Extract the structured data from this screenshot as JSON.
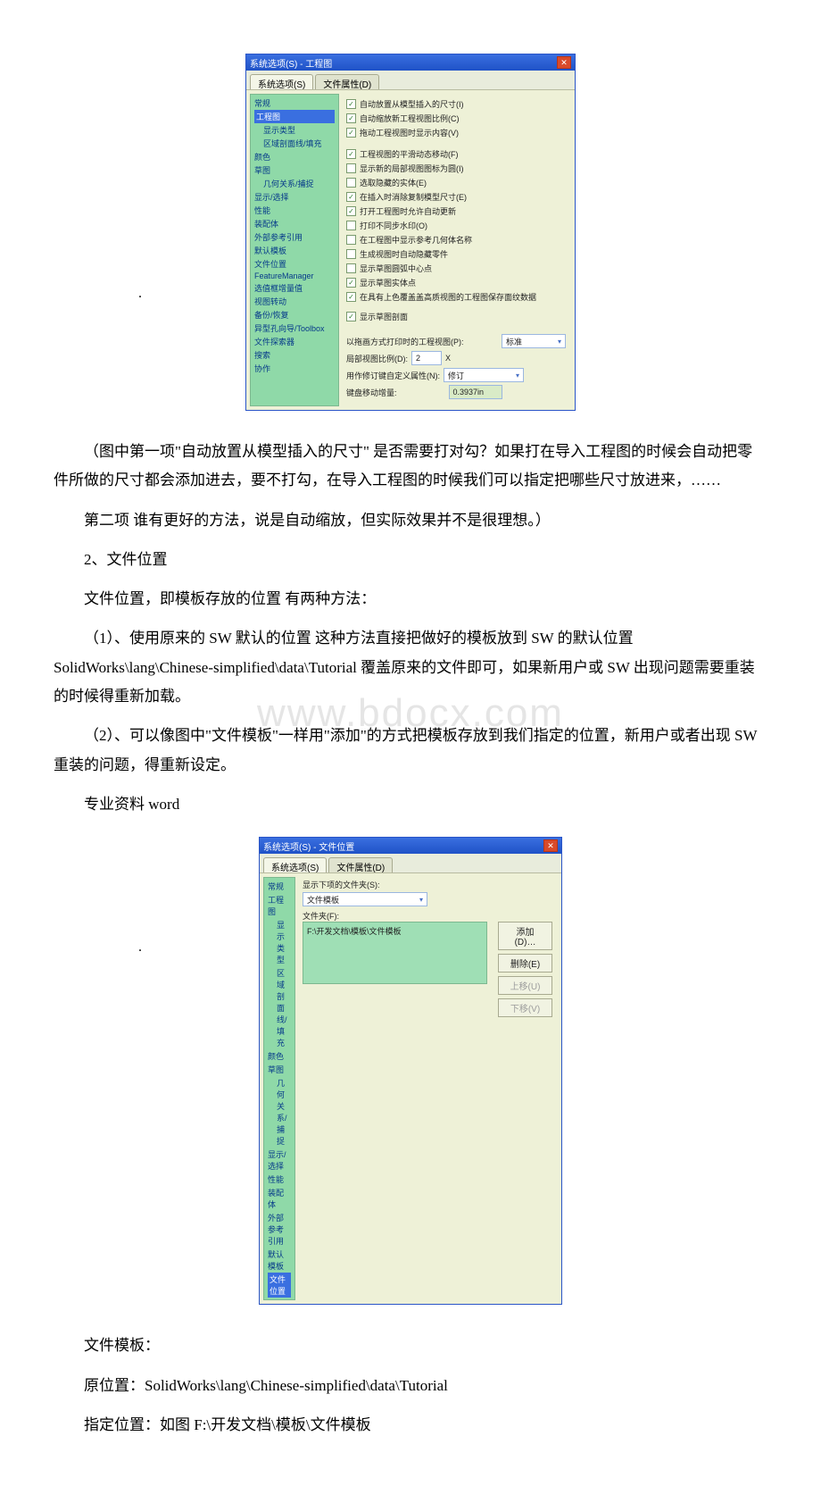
{
  "dialog1": {
    "title": "系统选项(S) - 工程图",
    "tab_system": "系统选项(S)",
    "tab_doc": "文件属性(D)",
    "tree": {
      "t0": "常规",
      "t1": "工程图",
      "t2": "显示类型",
      "t3": "区域剖面线/填充",
      "t4": "颜色",
      "t5": "草图",
      "t6": "几何关系/捕捉",
      "t7": "显示/选择",
      "t8": "性能",
      "t9": "装配体",
      "t10": "外部参考引用",
      "t11": "默认模板",
      "t12": "文件位置",
      "t13": "FeatureManager",
      "t14": "选值框增量值",
      "t15": "视图转动",
      "t16": "备份/恢复",
      "t17": "异型孔向导/Toolbox",
      "t18": "文件探索器",
      "t19": "搜索",
      "t20": "协作"
    },
    "opts": {
      "c0": "自动放置从模型插入的尺寸(I)",
      "c1": "自动缩放新工程视图比例(C)",
      "c2": "拖动工程视图时显示内容(V)",
      "c3": "工程视图的平滑动态移动(F)",
      "c4": "显示新的局部视图图标为圆(I)",
      "c5": "选取隐藏的实体(E)",
      "c6": "在插入时消除复制模型尺寸(E)",
      "c7": "打开工程图时允许自动更新",
      "c8": "打印不同步水印(O)",
      "c9": "在工程图中显示参考几何体名称",
      "c10": "生成视图时自动隐藏零件",
      "c11": "显示草图圆弧中心点",
      "c12": "显示草图实体点",
      "c13": "在具有上色覆盖盖高质视图的工程图保存面纹数据",
      "c14": "显示草图剖面",
      "l0": "以拖画方式打印时的工程视图(P):",
      "v0": "标准",
      "l1": "局部视图比例(D):",
      "v1": "2",
      "v1x": "X",
      "l2": "用作修订键自定义属性(N):",
      "v2": "修订",
      "l3": "键盘移动增量:",
      "v3": "0.3937in"
    }
  },
  "paras": {
    "p1": "（图中第一项\"自动放置从模型插入的尺寸\" 是否需要打对勾？如果打在导入工程图的时候会自动把零件所做的尺寸都会添加进去，要不打勾，在导入工程图的时候我们可以指定把哪些尺寸放进来，……",
    "p2": "第二项 谁有更好的方法，说是自动缩放，但实际效果并不是很理想。）",
    "p3": "2、文件位置",
    "p4": "文件位置，即模板存放的位置 有两种方法：",
    "p5": "（1）、使用原来的 SW 默认的位置 这种方法直接把做好的模板放到 SW 的默认位置 SolidWorks\\lang\\Chinese-simplified\\data\\Tutorial 覆盖原来的文件即可，如果新用户或 SW 出现问题需要重装的时候得重新加载。",
    "p6": "（2）、可以像图中\"文件模板\"一样用\"添加\"的方式把模板存放到我们指定的位置，新用户或者出现 SW 重装的问题，得重新设定。",
    "p7": "专业资料 word",
    "p8": "文件模板：",
    "p9": "原位置：SolidWorks\\lang\\Chinese-simplified\\data\\Tutorial",
    "p10": "指定位置：如图 F:\\开发文档\\模板\\文件模板"
  },
  "dialog2": {
    "title": "系统选项(S) - 文件位置",
    "tab_system": "系统选项(S)",
    "tab_doc": "文件属性(D)",
    "tree": {
      "t0": "常规",
      "t1": "工程图",
      "t2": "显示类型",
      "t3": "区域剖面线/填充",
      "t4": "颜色",
      "t5": "草图",
      "t6": "几何关系/捕捉",
      "t7": "显示/选择",
      "t8": "性能",
      "t9": "装配体",
      "t10": "外部参考引用",
      "t11": "默认模板",
      "t12": "文件位置"
    },
    "lbl_show": "显示下项的文件夹(S):",
    "combo_val": "文件模板",
    "lbl_folder": "文件夹(F):",
    "list_item": "F:\\开发文档\\模板\\文件模板",
    "btn_add": "添加(D)…",
    "btn_del": "删除(E)",
    "btn_up": "上移(U)",
    "btn_down": "下移(V)"
  },
  "watermark": "www.bdocx.com"
}
